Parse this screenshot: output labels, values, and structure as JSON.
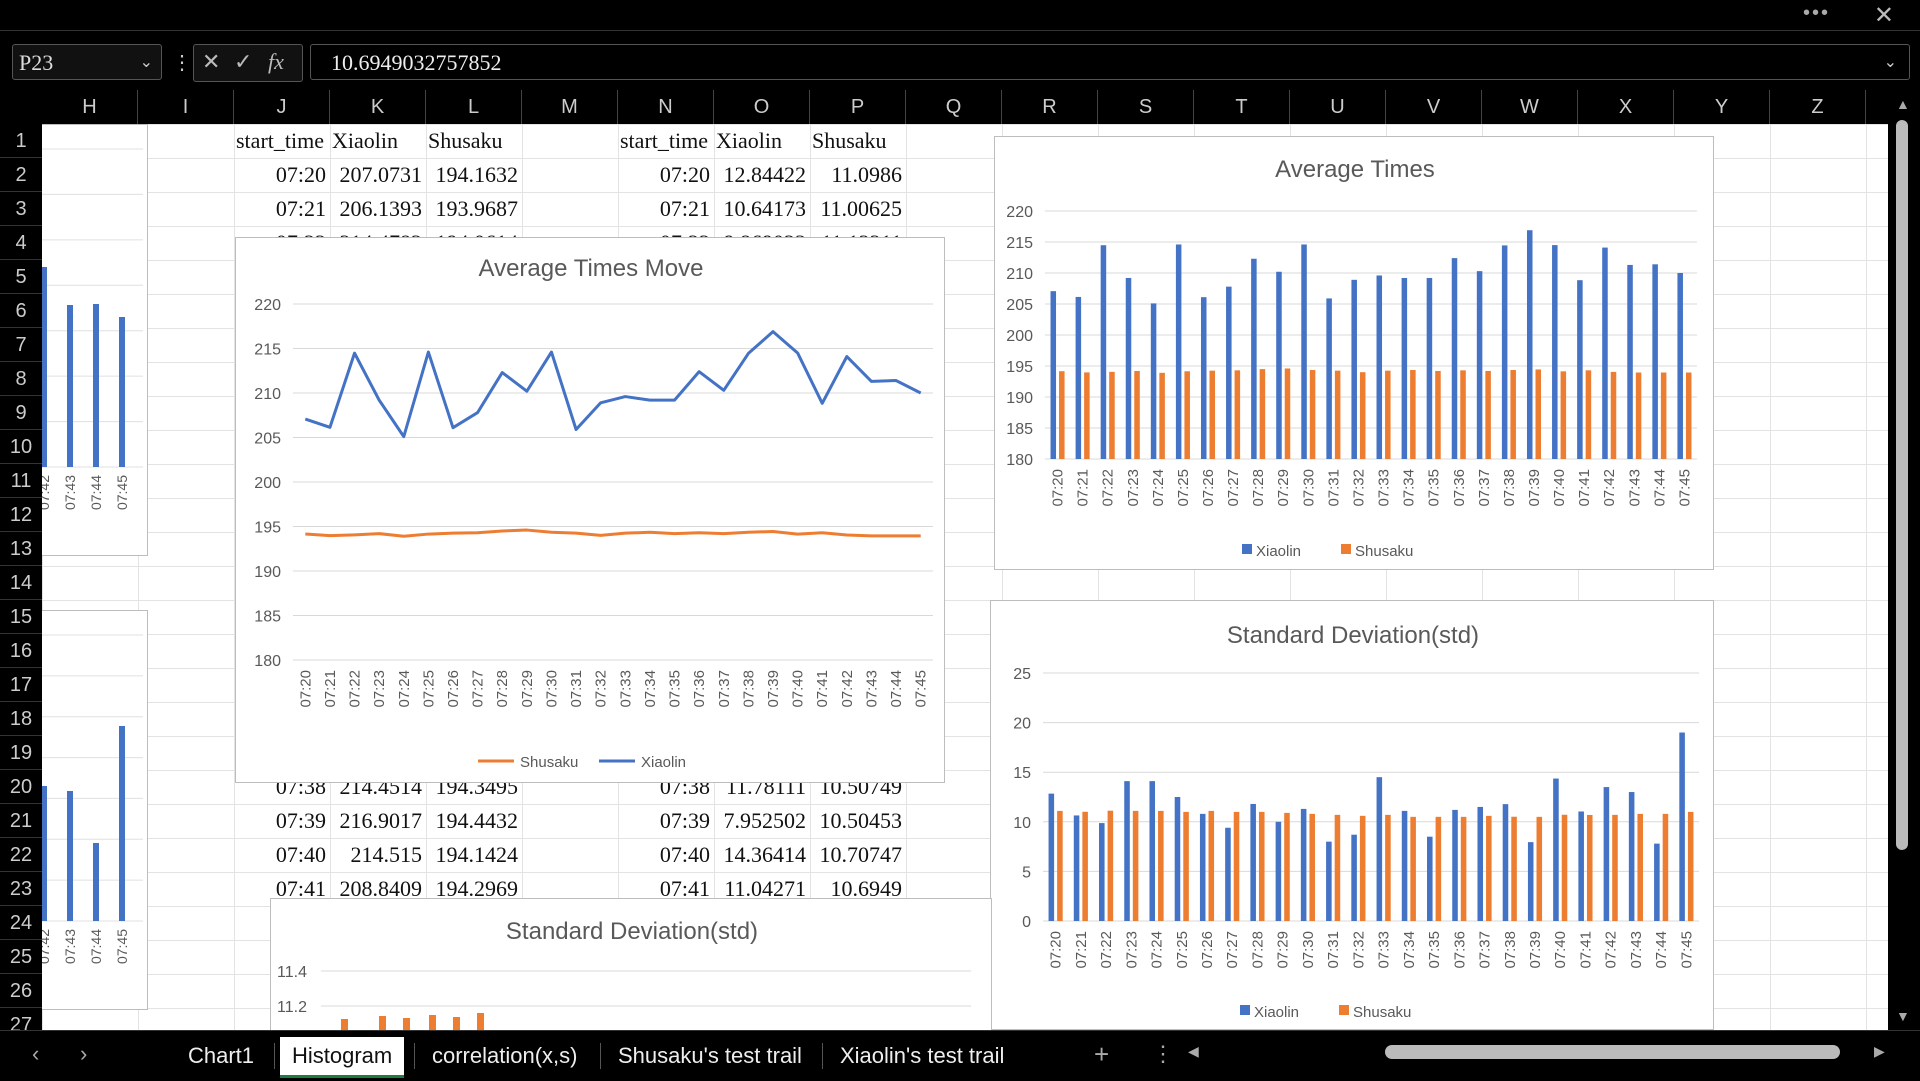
{
  "window": {
    "more_icon": "more-icon",
    "close_icon": "close-icon"
  },
  "formula_bar": {
    "name_box": "P23",
    "cancel_icon": "x-icon",
    "enter_icon": "check-icon",
    "fx_label": "fx",
    "formula": "10.6949032757852"
  },
  "columns": [
    "H",
    "I",
    "J",
    "K",
    "L",
    "M",
    "N",
    "O",
    "P",
    "Q",
    "R",
    "S",
    "T",
    "U",
    "V",
    "W",
    "X",
    "Y",
    "Z"
  ],
  "rows": [
    "1",
    "2",
    "3",
    "4",
    "5",
    "6",
    "7",
    "8",
    "9",
    "10",
    "11",
    "12",
    "13",
    "14",
    "15",
    "16",
    "17",
    "18",
    "19",
    "20",
    "21",
    "22",
    "23",
    "24",
    "25",
    "26",
    "27"
  ],
  "table_left": {
    "headers": [
      "start_time",
      "Xiaolin",
      "Shusaku"
    ],
    "rows": [
      [
        "07:20",
        "207.0731",
        "194.1632"
      ],
      [
        "07:21",
        "206.1393",
        "193.9687"
      ],
      [
        "07:22",
        "214.4782",
        "194.0614"
      ],
      [
        "07:38",
        "214.4514",
        "194.3495"
      ],
      [
        "07:39",
        "216.9017",
        "194.4432"
      ],
      [
        "07:40",
        "214.515",
        "194.1424"
      ],
      [
        "07:41",
        "208.8409",
        "194.2969"
      ]
    ]
  },
  "table_right": {
    "headers": [
      "start_time",
      "Xiaolin",
      "Shusaku"
    ],
    "rows": [
      [
        "07:20",
        "12.84422",
        "11.0986"
      ],
      [
        "07:21",
        "10.64173",
        "11.00625"
      ],
      [
        "07:22",
        "9.869023",
        "11.12211"
      ],
      [
        "07:38",
        "11.78111",
        "10.50749"
      ],
      [
        "07:39",
        "7.952502",
        "10.50453"
      ],
      [
        "07:40",
        "14.36414",
        "10.70747"
      ],
      [
        "07:41",
        "11.04271",
        "10.6949"
      ]
    ]
  },
  "tabs": {
    "items": [
      "Chart1",
      "Histogram",
      "correlation(x,s)",
      "Shusaku's test trail",
      "Xiaolin's test trail"
    ],
    "active": "Histogram",
    "add_icon": "plus-icon",
    "options_icon": "vertical-dots-icon"
  },
  "colors": {
    "xiaolin": "#4472C4",
    "shusaku": "#ED7D31"
  },
  "chart_data": [
    {
      "id": "line",
      "type": "line",
      "title": "Average Times Move",
      "categories": [
        "07:20",
        "07:21",
        "07:22",
        "07:23",
        "07:24",
        "07:25",
        "07:26",
        "07:27",
        "07:28",
        "07:29",
        "07:30",
        "07:31",
        "07:32",
        "07:33",
        "07:34",
        "07:35",
        "07:36",
        "07:37",
        "07:38",
        "07:39",
        "07:40",
        "07:41",
        "07:42",
        "07:43",
        "07:44",
        "07:45"
      ],
      "series": [
        {
          "name": "Shusaku",
          "values": [
            194.16,
            193.97,
            194.06,
            194.2,
            193.9,
            194.15,
            194.25,
            194.3,
            194.5,
            194.6,
            194.35,
            194.25,
            194.0,
            194.25,
            194.35,
            194.2,
            194.3,
            194.2,
            194.35,
            194.44,
            194.14,
            194.3,
            194.05,
            193.95,
            193.95,
            193.95
          ]
        },
        {
          "name": "Xiaolin",
          "values": [
            207.07,
            206.14,
            214.48,
            209.2,
            205.1,
            214.6,
            206.1,
            207.8,
            212.3,
            210.2,
            214.6,
            205.9,
            208.9,
            209.6,
            209.2,
            209.2,
            212.4,
            210.3,
            214.45,
            216.9,
            214.5,
            208.84,
            214.1,
            211.3,
            211.4,
            210.0
          ]
        }
      ],
      "yticks": [
        "220",
        "215",
        "210",
        "205",
        "200",
        "195",
        "190",
        "185",
        "180"
      ],
      "ylim": [
        180,
        220
      ],
      "legend": "bottom"
    },
    {
      "id": "avgbar",
      "type": "bar",
      "title": "Average Times",
      "categories": [
        "07:20",
        "07:21",
        "07:22",
        "07:23",
        "07:24",
        "07:25",
        "07:26",
        "07:27",
        "07:28",
        "07:29",
        "07:30",
        "07:31",
        "07:32",
        "07:33",
        "07:34",
        "07:35",
        "07:36",
        "07:37",
        "07:38",
        "07:39",
        "07:40",
        "07:41",
        "07:42",
        "07:43",
        "07:44",
        "07:45"
      ],
      "series": [
        {
          "name": "Xiaolin",
          "values": [
            207.07,
            206.14,
            214.48,
            209.2,
            205.1,
            214.6,
            206.1,
            207.8,
            212.3,
            210.2,
            214.6,
            205.9,
            208.9,
            209.6,
            209.2,
            209.2,
            212.4,
            210.3,
            214.45,
            216.9,
            214.5,
            208.84,
            214.1,
            211.3,
            211.4,
            210.0
          ]
        },
        {
          "name": "Shusaku",
          "values": [
            194.16,
            193.97,
            194.06,
            194.2,
            193.9,
            194.15,
            194.25,
            194.3,
            194.5,
            194.6,
            194.35,
            194.25,
            194.0,
            194.25,
            194.35,
            194.2,
            194.3,
            194.2,
            194.35,
            194.44,
            194.14,
            194.3,
            194.05,
            193.95,
            193.95,
            193.95
          ]
        }
      ],
      "yticks": [
        "220",
        "215",
        "210",
        "205",
        "200",
        "195",
        "190",
        "185",
        "180"
      ],
      "ylim": [
        180,
        220
      ],
      "legend": "bottom"
    },
    {
      "id": "stdbar",
      "type": "bar",
      "title": "Standard Deviation(std)",
      "categories": [
        "07:20",
        "07:21",
        "07:22",
        "07:23",
        "07:24",
        "07:25",
        "07:26",
        "07:27",
        "07:28",
        "07:29",
        "07:30",
        "07:31",
        "07:32",
        "07:33",
        "07:34",
        "07:35",
        "07:36",
        "07:37",
        "07:38",
        "07:39",
        "07:40",
        "07:41",
        "07:42",
        "07:43",
        "07:44",
        "07:45"
      ],
      "series": [
        {
          "name": "Xiaolin",
          "values": [
            12.84,
            10.64,
            9.87,
            14.1,
            14.1,
            12.5,
            10.8,
            9.4,
            11.8,
            10.0,
            11.3,
            8.0,
            8.7,
            14.5,
            11.1,
            8.5,
            11.2,
            11.5,
            11.78,
            7.95,
            14.36,
            11.04,
            13.5,
            13.0,
            7.8,
            19.0
          ]
        },
        {
          "name": "Shusaku",
          "values": [
            11.1,
            11.01,
            11.12,
            11.1,
            11.1,
            11.0,
            11.1,
            11.0,
            11.0,
            10.9,
            10.8,
            10.7,
            10.6,
            10.7,
            10.5,
            10.5,
            10.5,
            10.6,
            10.51,
            10.5,
            10.71,
            10.69,
            10.7,
            10.8,
            10.8,
            11.0
          ]
        }
      ],
      "yticks": [
        "25",
        "20",
        "15",
        "10",
        "5",
        "0"
      ],
      "ylim": [
        0,
        25
      ],
      "legend": "bottom"
    },
    {
      "id": "stdsmall",
      "type": "bar",
      "title": "Standard Deviation(std)",
      "yticks": [
        "11.4",
        "11.2"
      ]
    },
    {
      "id": "leftmini1",
      "type": "bar",
      "categories": [
        "07:42",
        "07:43",
        "07:44",
        "07:45"
      ]
    },
    {
      "id": "leftmini2",
      "type": "bar",
      "categories": [
        "07:42",
        "07:43",
        "07:44",
        "07:45"
      ]
    }
  ]
}
